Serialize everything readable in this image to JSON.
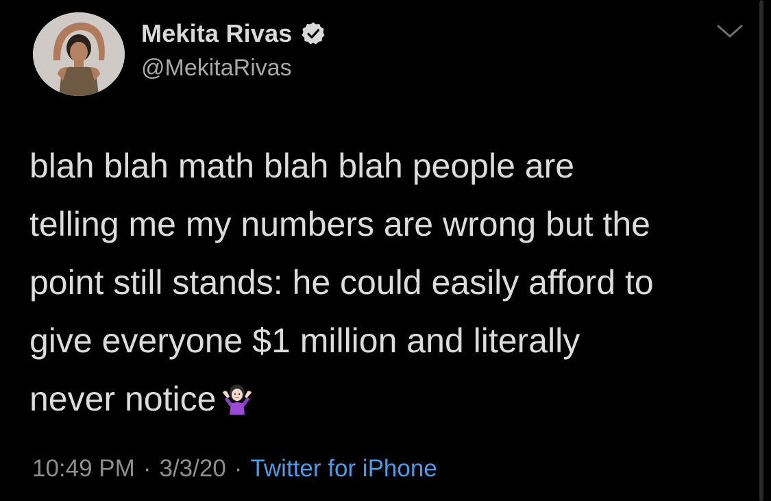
{
  "author": {
    "display_name": "Mekita Rivas",
    "handle": "@MekitaRivas",
    "verified": true
  },
  "tweet": {
    "lines": [
      "blah blah math blah blah people are",
      "telling me my numbers are wrong but the",
      "point still stands: he could easily afford to",
      "give everyone $1 million and literally",
      "never notice"
    ],
    "emoji": "person-shrugging-emoji",
    "time": "10:49 PM",
    "date": "3/3/20",
    "separator": "·",
    "source": "Twitter for iPhone"
  },
  "icons": {
    "verified": "verified-badge-icon",
    "more": "chevron-down-icon"
  },
  "colors": {
    "background": "#000000",
    "text": "#dcdcdc",
    "secondary": "#8e8e8e",
    "link": "#4a9be8"
  }
}
